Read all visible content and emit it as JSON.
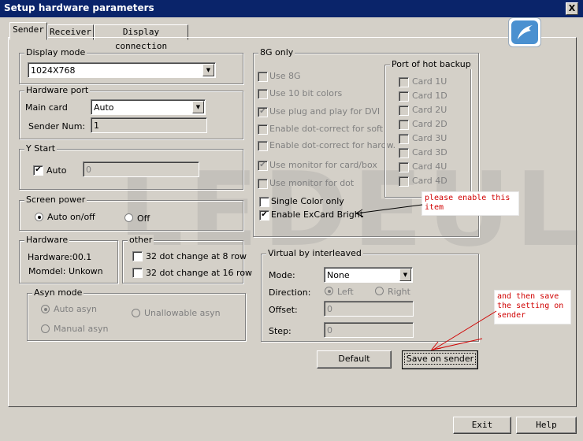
{
  "window": {
    "title": "Setup hardware parameters",
    "close_label": "X"
  },
  "tabs": [
    "Sender",
    "Receiver",
    "Display connection"
  ],
  "watermark": "LEDEUL",
  "display_mode": {
    "label": "Display mode",
    "value": "1024X768"
  },
  "hardware_port": {
    "label": "Hardware port",
    "main_card_label": "Main card",
    "main_card_value": "Auto",
    "sender_num_label": "Sender Num:",
    "sender_num_value": "1"
  },
  "y_start": {
    "label": "Y Start",
    "auto_label": "Auto",
    "value": "0"
  },
  "screen_power": {
    "label": "Screen power",
    "auto_label": "Auto on/off",
    "off_label": "Off"
  },
  "hardware": {
    "label": "Hardware",
    "version": "Hardware:00.1",
    "momdel": "Momdel: Unkown"
  },
  "other": {
    "label": "other",
    "opt1": "32 dot change at 8 row",
    "opt2": "32 dot change at 16 row"
  },
  "asyn_mode": {
    "label": "Asyn mode",
    "auto": "Auto asyn",
    "unallowable": "Unallowable asyn",
    "manual": "Manual asyn"
  },
  "only_8g": {
    "label": "8G only",
    "options": [
      "Use 8G",
      "Use 10 bit colors",
      "Use plug and play for DVI",
      "Enable dot-correct for soft",
      "Enable dot-correct for hardw.",
      "Use monitor for card/box",
      "Use monitor for dot"
    ],
    "single_color": "Single Color only",
    "excard_bright": "Enable ExCard Bright"
  },
  "hot_backup": {
    "label": "Port of hot backup",
    "cards": [
      "Card 1U",
      "Card 1D",
      "Card 2U",
      "Card 2D",
      "Card 3U",
      "Card 3D",
      "Card 4U",
      "Card 4D"
    ]
  },
  "virtual": {
    "label": "Virtual by interleaved",
    "mode_label": "Mode:",
    "mode_value": "None",
    "direction_label": "Direction:",
    "left": "Left",
    "right": "Right",
    "offset_label": "Offset:",
    "offset_value": "0",
    "step_label": "Step:",
    "step_value": "0"
  },
  "buttons": {
    "default": "Default",
    "save": "Save on sender",
    "exit": "Exit",
    "help": "Help"
  },
  "annotations": {
    "note1": [
      "please enable this",
      "item"
    ],
    "note2": [
      "and then save",
      "the setting on",
      "sender"
    ]
  },
  "colors": {
    "titlebar": "#0a246a",
    "face": "#d4d0c8",
    "annotation": "#d00000"
  }
}
